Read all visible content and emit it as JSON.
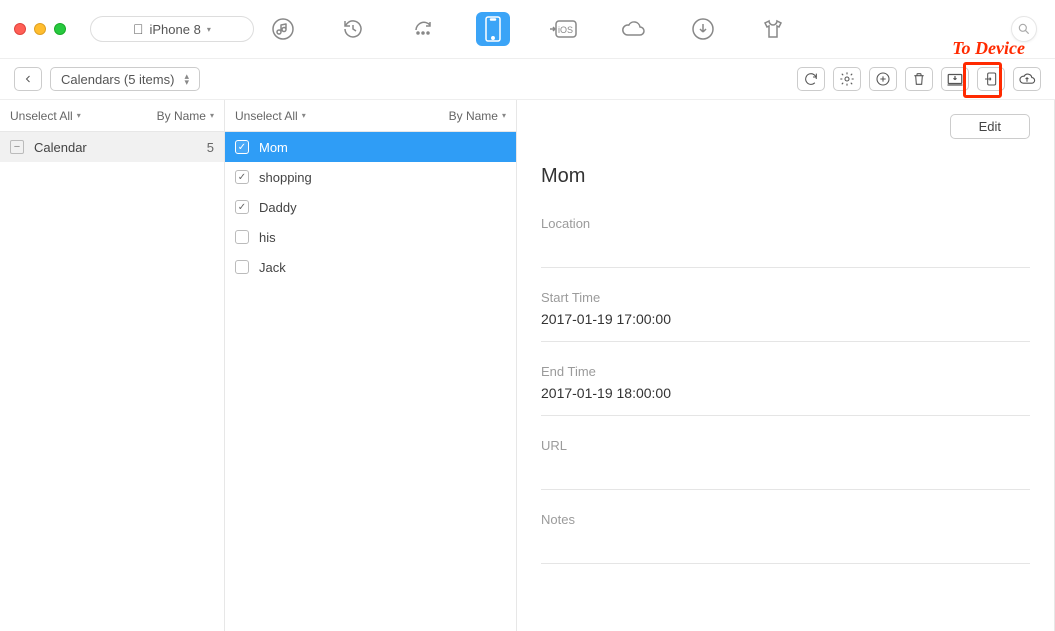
{
  "device": {
    "label": "iPhone 8"
  },
  "annotation": "To Device",
  "breadcrumb": {
    "label": "Calendars (5 items)"
  },
  "column1": {
    "unselect_label": "Unselect All",
    "sort_label": "By Name",
    "category": {
      "name": "Calendar",
      "count": "5"
    }
  },
  "column2": {
    "unselect_label": "Unselect All",
    "sort_label": "By Name",
    "items": [
      {
        "name": "Mom",
        "checked": true,
        "selected": true
      },
      {
        "name": "shopping",
        "checked": true,
        "selected": false
      },
      {
        "name": "Daddy",
        "checked": true,
        "selected": false
      },
      {
        "name": "his",
        "checked": false,
        "selected": false
      },
      {
        "name": "Jack",
        "checked": false,
        "selected": false
      }
    ]
  },
  "detail": {
    "edit_label": "Edit",
    "title": "Mom",
    "location_label": "Location",
    "location_value": "",
    "start_label": "Start Time",
    "start_value": "2017-01-19 17:00:00",
    "end_label": "End Time",
    "end_value": "2017-01-19 18:00:00",
    "url_label": "URL",
    "url_value": "",
    "notes_label": "Notes",
    "notes_value": ""
  }
}
